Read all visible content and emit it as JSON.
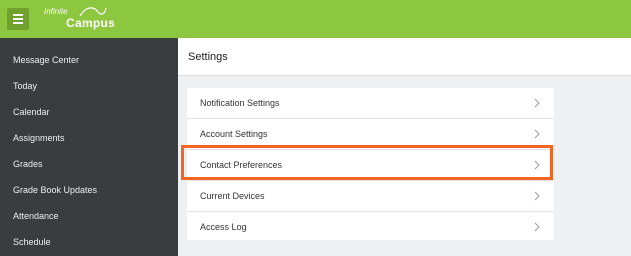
{
  "header": {
    "logo_line1": "Infinite",
    "logo_line2": "Campus",
    "brand_color": "#8dc63f"
  },
  "sidebar": {
    "items": [
      {
        "label": "Message Center"
      },
      {
        "label": "Today"
      },
      {
        "label": "Calendar"
      },
      {
        "label": "Assignments"
      },
      {
        "label": "Grades"
      },
      {
        "label": "Grade Book Updates"
      },
      {
        "label": "Attendance"
      },
      {
        "label": "Schedule"
      }
    ]
  },
  "main": {
    "title": "Settings",
    "settings": [
      {
        "label": "Notification Settings",
        "icon": "chevron-right-icon"
      },
      {
        "label": "Account Settings",
        "icon": "chevron-right-icon"
      },
      {
        "label": "Contact Preferences",
        "icon": "chevron-right-icon",
        "highlighted": true
      },
      {
        "label": "Current Devices",
        "icon": "chevron-right-icon"
      },
      {
        "label": "Access Log",
        "icon": "chevron-right-icon"
      }
    ],
    "highlight_color": "#f26522"
  }
}
